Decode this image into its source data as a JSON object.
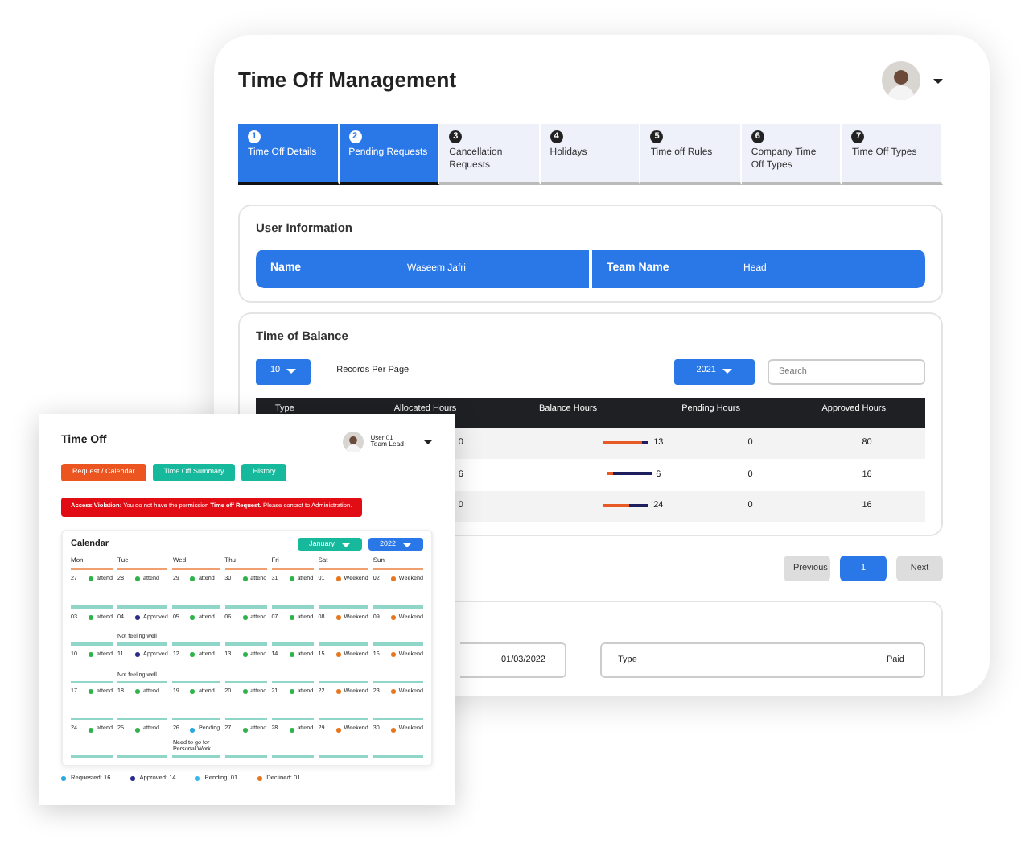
{
  "main_window": {
    "title": "Time Off Management",
    "tabs": [
      {
        "number": "1",
        "label": "Time Off Details",
        "active": true
      },
      {
        "number": "2",
        "label": "Pending Requests",
        "active": true
      },
      {
        "number": "3",
        "label": "Cancellation Requests",
        "active": false
      },
      {
        "number": "4",
        "label": "Holidays",
        "active": false
      },
      {
        "number": "5",
        "label": "Time off Rules",
        "active": false
      },
      {
        "number": "6",
        "label": "Company Time Off Types",
        "active": false
      },
      {
        "number": "7",
        "label": "Time Off Types",
        "active": false
      }
    ],
    "user_information": {
      "title": "User Information",
      "fields": [
        {
          "label": "Name",
          "value": "Waseem Jafri"
        },
        {
          "label": "Team Name",
          "value": "Head"
        }
      ]
    },
    "time_of_balance": {
      "title": "Time of Balance",
      "per_page": "10",
      "per_page_label": "Records Per Page",
      "year": "2021",
      "search": {
        "placeholder": "Search"
      },
      "columns": [
        "Type",
        "Allocated Hours",
        "Balance Hours",
        "Pending Hours",
        "Approved Hours"
      ],
      "rows": [
        {
          "allocated": "0",
          "balance": "13",
          "level": 0.85,
          "pending": "0",
          "approved": "80"
        },
        {
          "allocated": "6",
          "balance": "6",
          "level": 0.15,
          "pending": "0",
          "approved": "16"
        },
        {
          "allocated": "0",
          "balance": "24",
          "level": 0.55,
          "pending": "0",
          "approved": "16"
        }
      ]
    },
    "pagination": {
      "previous": "Previous",
      "pages": [
        {
          "label": "1",
          "selected": true
        }
      ],
      "next": "Next"
    },
    "details": {
      "fields": [
        {
          "value": "01/03/2022"
        },
        {
          "label": "Type",
          "value": "Paid"
        }
      ]
    }
  },
  "small_window": {
    "title": "Time Off",
    "user": {
      "name": "User 01",
      "role": "Team Lead"
    },
    "buttons": [
      {
        "label": "Request / Calendar",
        "selected": true
      },
      {
        "label": "Time Off Summary",
        "selected": false
      },
      {
        "label": "History",
        "selected": false
      }
    ],
    "alert": "**Access Violation:** You do not have the permission **Time off Request.** Please contact to Administration.",
    "calendar": {
      "title": "Calendar",
      "month": "January",
      "year": "2022",
      "days": [
        "Mon",
        "Tue",
        "Wed",
        "Thu",
        "Fri",
        "Sat",
        "Sun"
      ],
      "weeks": [
        [
          {
            "date": "27",
            "status": "attend",
            "color": "#2db34a"
          },
          {
            "date": "28",
            "status": "attend",
            "color": "#2db34a"
          },
          {
            "date": "29",
            "status": "attend",
            "color": "#2db34a"
          },
          {
            "date": "30",
            "status": "attend",
            "color": "#2db34a"
          },
          {
            "date": "31",
            "status": "attend",
            "color": "#2db34a"
          },
          {
            "date": "01",
            "status": "Weekend",
            "color": "#e8761e"
          },
          {
            "date": "02",
            "status": "Weekend",
            "color": "#e8761e"
          }
        ],
        [
          {
            "date": "03",
            "status": "attend",
            "color": "#2db34a"
          },
          {
            "date": "04",
            "status": "Approved",
            "color": "#2a2a8c",
            "note": "Not feeling well"
          },
          {
            "date": "05",
            "status": "attend",
            "color": "#2db34a"
          },
          {
            "date": "06",
            "status": "attend",
            "color": "#2db34a"
          },
          {
            "date": "07",
            "status": "attend",
            "color": "#2db34a"
          },
          {
            "date": "08",
            "status": "Weekend",
            "color": "#e8761e"
          },
          {
            "date": "09",
            "status": "Weekend",
            "color": "#e8761e"
          }
        ],
        [
          {
            "date": "10",
            "status": "attend",
            "color": "#2db34a"
          },
          {
            "date": "11",
            "status": "Approved",
            "color": "#2a2a8c",
            "note": "Not feeling well"
          },
          {
            "date": "12",
            "status": "attend",
            "color": "#2db34a"
          },
          {
            "date": "13",
            "status": "attend",
            "color": "#2db34a"
          },
          {
            "date": "14",
            "status": "attend",
            "color": "#2db34a"
          },
          {
            "date": "15",
            "status": "Weekend",
            "color": "#e8761e"
          },
          {
            "date": "16",
            "status": "Weekend",
            "color": "#e8761e"
          }
        ],
        [
          {
            "date": "17",
            "status": "attend",
            "color": "#2db34a"
          },
          {
            "date": "18",
            "status": "attend",
            "color": "#2db34a"
          },
          {
            "date": "19",
            "status": "attend",
            "color": "#2db34a"
          },
          {
            "date": "20",
            "status": "attend",
            "color": "#2db34a"
          },
          {
            "date": "21",
            "status": "attend",
            "color": "#2db34a"
          },
          {
            "date": "22",
            "status": "Weekend",
            "color": "#e8761e"
          },
          {
            "date": "23",
            "status": "Weekend",
            "color": "#e8761e"
          }
        ],
        [
          {
            "date": "24",
            "status": "attend",
            "color": "#2db34a"
          },
          {
            "date": "25",
            "status": "attend",
            "color": "#2db34a"
          },
          {
            "date": "26",
            "status": "Pending",
            "color": "#2aa7df",
            "note": "Need to go for Personal Work"
          },
          {
            "date": "27",
            "status": "attend",
            "color": "#2db34a"
          },
          {
            "date": "28",
            "status": "attend",
            "color": "#2db34a"
          },
          {
            "date": "29",
            "status": "Weekend",
            "color": "#e8761e"
          },
          {
            "date": "30",
            "status": "Weekend",
            "color": "#e8761e"
          }
        ]
      ]
    },
    "legend": [
      {
        "label": "Requested: 16",
        "color": "#2aa7df"
      },
      {
        "label": "Approved: 14",
        "color": "#2a2a8c"
      },
      {
        "label": "Pending: 01",
        "color": "#39b8e8"
      },
      {
        "label": "Declined: 01",
        "color": "#e8761e"
      }
    ]
  }
}
